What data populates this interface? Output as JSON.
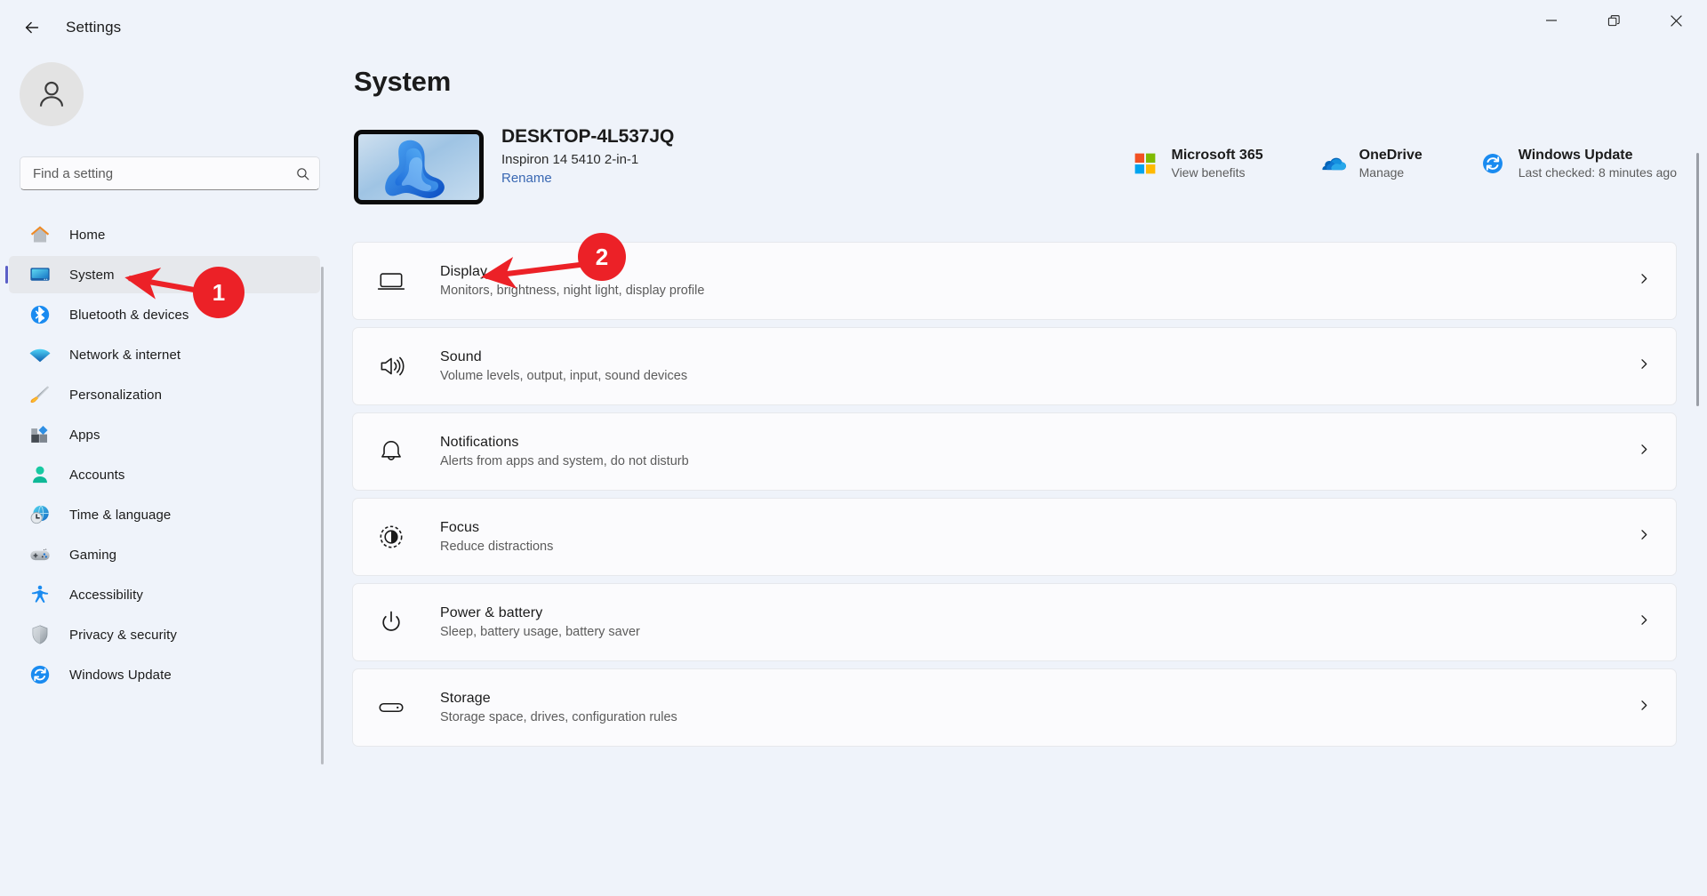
{
  "window": {
    "title": "Settings",
    "back_label": "Back",
    "controls": {
      "minimize": "Minimize",
      "maximize": "Restore",
      "close": "Close"
    }
  },
  "sidebar": {
    "account_name": "",
    "search": {
      "placeholder": "Find a setting",
      "value": "",
      "icon": "search-icon"
    },
    "items": [
      {
        "label": "Home",
        "icon": "home-icon",
        "selected": false
      },
      {
        "label": "System",
        "icon": "system-icon",
        "selected": true
      },
      {
        "label": "Bluetooth & devices",
        "icon": "bluetooth-icon",
        "selected": false
      },
      {
        "label": "Network & internet",
        "icon": "wifi-icon",
        "selected": false
      },
      {
        "label": "Personalization",
        "icon": "paintbrush-icon",
        "selected": false
      },
      {
        "label": "Apps",
        "icon": "apps-icon",
        "selected": false
      },
      {
        "label": "Accounts",
        "icon": "person-icon",
        "selected": false
      },
      {
        "label": "Time & language",
        "icon": "clock-globe-icon",
        "selected": false
      },
      {
        "label": "Gaming",
        "icon": "gamepad-icon",
        "selected": false
      },
      {
        "label": "Accessibility",
        "icon": "accessibility-icon",
        "selected": false
      },
      {
        "label": "Privacy & security",
        "icon": "shield-icon",
        "selected": false
      },
      {
        "label": "Windows Update",
        "icon": "update-icon",
        "selected": false
      }
    ]
  },
  "main": {
    "page_title": "System",
    "device": {
      "name": "DESKTOP-4L537JQ",
      "model": "Inspiron 14 5410 2-in-1",
      "rename_label": "Rename"
    },
    "quick_links": [
      {
        "title": "Microsoft 365",
        "subtitle": "View benefits",
        "icon": "microsoft-logo-icon"
      },
      {
        "title": "OneDrive",
        "subtitle": "Manage",
        "icon": "onedrive-icon"
      },
      {
        "title": "Windows Update",
        "subtitle": "Last checked: 8 minutes ago",
        "icon": "update-icon"
      }
    ],
    "cards": [
      {
        "title": "Display",
        "subtitle": "Monitors, brightness, night light, display profile",
        "icon": "display-icon"
      },
      {
        "title": "Sound",
        "subtitle": "Volume levels, output, input, sound devices",
        "icon": "speaker-icon"
      },
      {
        "title": "Notifications",
        "subtitle": "Alerts from apps and system, do not disturb",
        "icon": "bell-icon"
      },
      {
        "title": "Focus",
        "subtitle": "Reduce distractions",
        "icon": "focus-icon"
      },
      {
        "title": "Power & battery",
        "subtitle": "Sleep, battery usage, battery saver",
        "icon": "power-icon"
      },
      {
        "title": "Storage",
        "subtitle": "Storage space, drives, configuration rules",
        "icon": "storage-icon"
      }
    ]
  },
  "annotations": {
    "color": "#ec2127",
    "markers": [
      {
        "number": "1",
        "target": "sidebar-item-system"
      },
      {
        "number": "2",
        "target": "card-display"
      }
    ]
  }
}
